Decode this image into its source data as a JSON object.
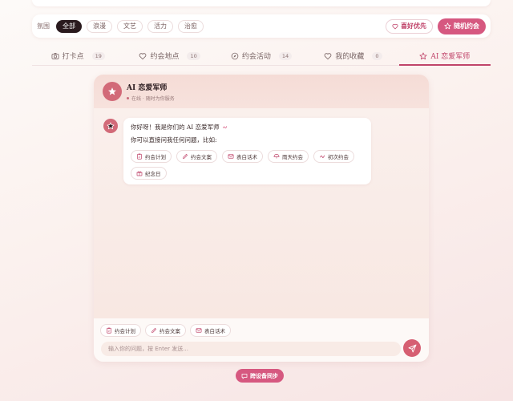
{
  "filter": {
    "label": "氛围",
    "chips": [
      "全部",
      "浪漫",
      "文艺",
      "活力",
      "治愈"
    ],
    "preference_btn": "喜好优先",
    "random_btn": "随机约会"
  },
  "tabs": [
    {
      "label": "打卡点",
      "count": "19",
      "icon": "camera-icon"
    },
    {
      "label": "约会地点",
      "count": "10",
      "icon": "heart-icon"
    },
    {
      "label": "约会活动",
      "count": "14",
      "icon": "compass-icon"
    },
    {
      "label": "我的收藏",
      "count": "0",
      "icon": "heart-icon"
    },
    {
      "label": "AI 恋爱军师",
      "icon": "star-icon"
    }
  ],
  "chat": {
    "title": "AI 恋爱军师",
    "status": "在线 · 随时为你服务",
    "greeting": "你好呀！我是你们的 AI 恋爱军师",
    "prompt": "你可以直接问我任何问题，比如:",
    "suggestions": [
      "约会计划",
      "约会文案",
      "表白话术",
      "雨天约会",
      "初次约会",
      "纪念日"
    ],
    "quick_actions": [
      "约会计划",
      "约会文案",
      "表白话术"
    ],
    "input_placeholder": "输入你的问题，按 Enter 发送..."
  },
  "sync_btn": "跨设备同步",
  "colors": {
    "accent": "#d65880",
    "dark_chip": "#2a1a1e",
    "avatar": "#d26a78"
  }
}
